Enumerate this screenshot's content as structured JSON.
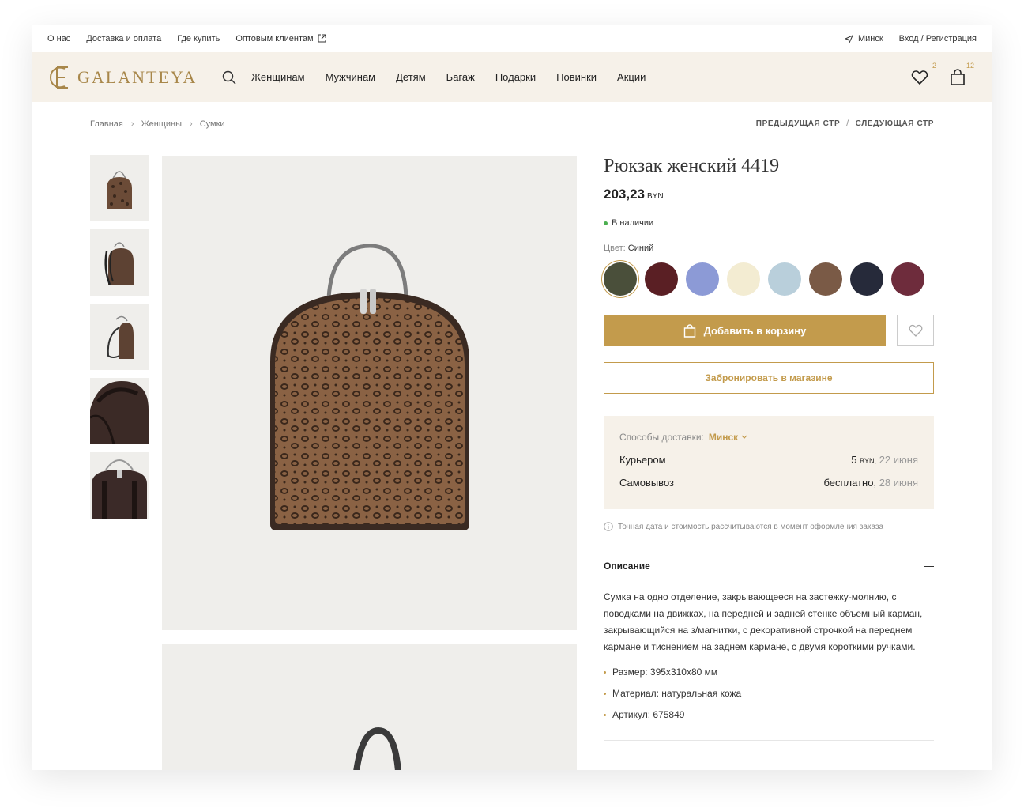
{
  "topbar": {
    "links": [
      "О нас",
      "Доставка и оплата",
      "Где купить",
      "Оптовым клиентам"
    ],
    "city": "Минск",
    "auth": "Вход / Регистрация"
  },
  "header": {
    "logo_text": "GALANTEYA",
    "nav": [
      "Женщинам",
      "Мужчинам",
      "Детям",
      "Багаж",
      "Подарки",
      "Новинки",
      "Акции"
    ],
    "wishlist_count": "2",
    "cart_count": "12"
  },
  "breadcrumbs": [
    "Главная",
    "Женщины",
    "Сумки"
  ],
  "pager": {
    "prev": "ПРЕДЫДУЩАЯ СТР",
    "sep": "/",
    "next": "СЛЕДУЮЩАЯ СТР"
  },
  "product": {
    "title": "Рюкзак женский 4419",
    "price": "203,23",
    "currency": "BYN",
    "stock": "В наличии",
    "color_label": "Цвет:",
    "color_value": "Синий",
    "swatches": [
      "#4a4f3a",
      "#5a1f24",
      "#8c9ad6",
      "#f3ecd2",
      "#b9cfdb",
      "#7a5a46",
      "#262a3a",
      "#6e2c3c"
    ],
    "add_to_cart": "Добавить в корзину",
    "reserve": "Забронировать в магазине"
  },
  "delivery": {
    "label": "Способы доставки:",
    "city": "Минск",
    "rows": [
      {
        "name": "Курьером",
        "price": "5",
        "unit": "BYN,",
        "date": "22 июня"
      },
      {
        "name": "Самовывоз",
        "price": "бесплатно,",
        "unit": "",
        "date": "28 июня"
      }
    ],
    "note": "Точная дата и стоимость рассчитываются в момент оформления заказа"
  },
  "description": {
    "title": "Описание",
    "text": "Сумка на одно отделение, закрывающееся на застежку-молнию, с поводками на движках, на передней и задней стенке объемный карман, закрывающийся на з/магнитки, с декоративной строчкой на переднем кармане и тиснением на заднем кармане, с двумя короткими ручками.",
    "specs": [
      "Размер: 395x310x80 мм",
      "Материал: натуральная кожа",
      "Артикул: 675849"
    ]
  },
  "colors": {
    "accent": "#c39b4c",
    "header_bg": "#f6f1e9",
    "image_bg": "#efeeeb"
  }
}
